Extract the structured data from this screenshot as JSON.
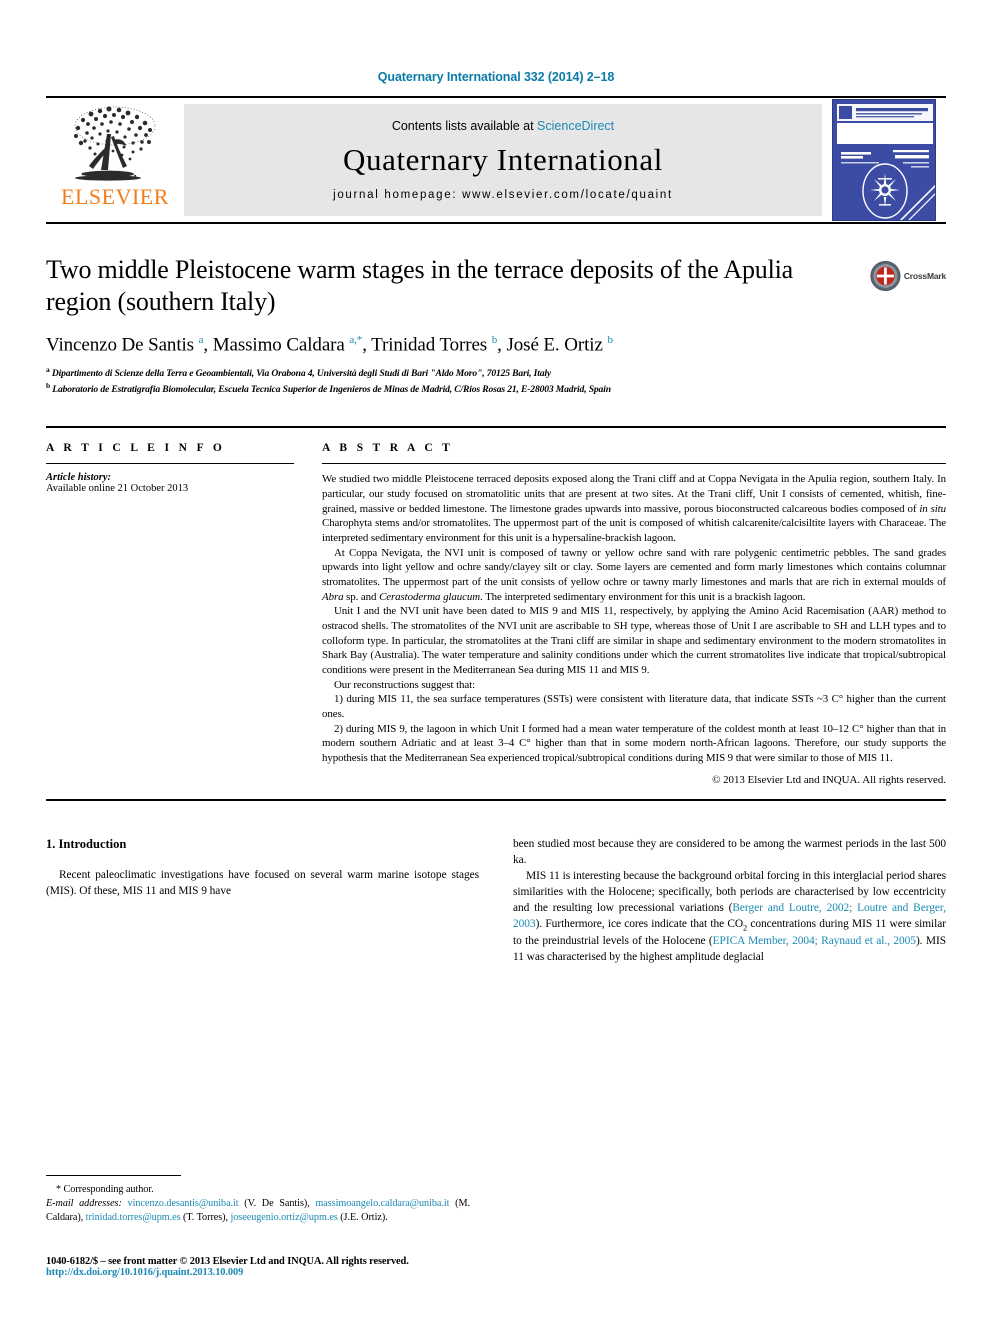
{
  "running_head": "Quaternary International 332 (2014) 2–18",
  "masthead": {
    "publisher": "ELSEVIER",
    "contents_prefix": "Contents lists available at ",
    "contents_link": "ScienceDirect",
    "journal_name": "Quaternary International",
    "homepage": "journal homepage: www.elsevier.com/locate/quaint",
    "cover_title": "QUATERNARY INTERNATIONAL",
    "cover_subtitle": "The Journal of the International Union for Quaternary Research"
  },
  "article": {
    "title": "Two middle Pleistocene warm stages in the terrace deposits of the Apulia region (southern Italy)",
    "crossmark_label": "CrossMark",
    "authors_html": "Vincenzo De Santis <sup>a</sup>, Massimo Caldara <sup>a,*</sup>, Trinidad Torres <sup>b</sup>, José E. Ortiz <sup>b</sup>",
    "affiliations": [
      "Dipartimento di Scienze della Terra e Geoambientali, Via Orabona 4, Università degli Studi di Bari \"Aldo Moro\", 70125 Bari, Italy",
      "Laboratorio de Estratigrafia Biomolecular, Escuela Tecnica Superior de Ingenieros de Minas de Madrid, C/Rios Rosas 21, E-28003 Madrid, Spain"
    ],
    "affiliation_markers": [
      "a",
      "b"
    ]
  },
  "article_info": {
    "heading": "A R T I C L E   I N F O",
    "history_label": "Article history:",
    "history_value": "Available online 21 October 2013"
  },
  "abstract": {
    "heading": "A B S T R A C T",
    "paragraphs": [
      "We studied two middle Pleistocene terraced deposits exposed along the Trani cliff and at Coppa Nevigata in the Apulia region, southern Italy. In particular, our study focused on stromatolitic units that are present at two sites. At the Trani cliff, Unit I consists of cemented, whitish, fine-grained, massive or bedded limestone. The limestone grades upwards into massive, porous bioconstructed calcareous bodies composed of in situ Charophyta stems and/or stromatolites. The uppermost part of the unit is composed of whitish calcarenite/calcisiltite layers with Characeae. The interpreted sedimentary environment for this unit is a hypersaline-brackish lagoon.",
      "At Coppa Nevigata, the NVI unit is composed of tawny or yellow ochre sand with rare polygenic centimetric pebbles. The sand grades upwards into light yellow and ochre sandy/clayey silt or clay. Some layers are cemented and form marly limestones which contains columnar stromatolites. The uppermost part of the unit consists of yellow ochre or tawny marly limestones and marls that are rich in external moulds of Abra sp. and Cerastoderma glaucum. The interpreted sedimentary environment for this unit is a brackish lagoon.",
      "Unit I and the NVI unit have been dated to MIS 9 and MIS 11, respectively, by applying the Amino Acid Racemisation (AAR) method to ostracod shells. The stromatolites of the NVI unit are ascribable to SH type, whereas those of Unit I are ascribable to SH and LLH types and to colloform type. In particular, the stromatolites at the Trani cliff are similar in shape and sedimentary environment to the modern stromatolites in Shark Bay (Australia). The water temperature and salinity conditions under which the current stromatolites live indicate that tropical/subtropical conditions were present in the Mediterranean Sea during MIS 11 and MIS 9.",
      "Our reconstructions suggest that:",
      "1) during MIS 11, the sea surface temperatures (SSTs) were consistent with literature data, that indicate SSTs ~3 C° higher than the current ones.",
      "2) during MIS 9, the lagoon in which Unit I formed had a mean water temperature of the coldest month at least 10–12 C° higher than that in modern southern Adriatic and at least 3–4 C° higher than that in some modern north-African lagoons. Therefore, our study supports the hypothesis that the Mediterranean Sea experienced tropical/subtropical conditions during MIS 9 that were similar to those of MIS 11."
    ],
    "copyright": "© 2013 Elsevier Ltd and INQUA. All rights reserved."
  },
  "introduction": {
    "heading": "1.  Introduction",
    "left_paragraph": "Recent paleoclimatic investigations have focused on several warm marine isotope stages (MIS). Of these, MIS 11 and MIS 9 have",
    "right_continuation": "been studied most because they are considered to be among the warmest periods in the last 500 ka.",
    "right_paragraph_html": "MIS 11 is interesting because the background orbital forcing in this interglacial period shares similarities with the Holocene; specifically, both periods are characterised by low eccentricity and the resulting low precessional variations (<span class=\"lnk\">Berger and Loutre, 2002; Loutre and Berger, 2003</span>). Furthermore, ice cores indicate that the CO<sub>2</sub> concentrations during MIS 11 were similar to the preindustrial levels of the Holocene (<span class=\"lnk\">EPICA Member, 2004; Raynaud et al., 2005</span>). MIS 11 was characterised by the highest amplitude deglacial"
  },
  "footnote": {
    "corresponding": "* Corresponding author.",
    "email_label": "E-mail addresses:",
    "emails_html": "<span class=\"lnk\">vincenzo.desantis@uniba.it</span> (V. De Santis), <span class=\"lnk\">massimoangelo.caldara@uniba.it</span> (M. Caldara), <span class=\"lnk\">trinidad.torres@upm.es</span> (T. Torres), <span class=\"lnk\">joseeugenio.ortiz@upm.es</span> (J.E. Ortiz)."
  },
  "footer": {
    "issn_line": "1040-6182/$ – see front matter © 2013 Elsevier Ltd and INQUA. All rights reserved.",
    "doi": "http://dx.doi.org/10.1016/j.quaint.2013.10.009"
  },
  "colors": {
    "link": "#1b8ab5",
    "running_head": "#0b7ba8",
    "elsevier_orange": "#f07d1b",
    "band_gray": "#e6e6e6",
    "cover_blue": "#3c4ba4",
    "crossmark_red": "#c0271c"
  }
}
